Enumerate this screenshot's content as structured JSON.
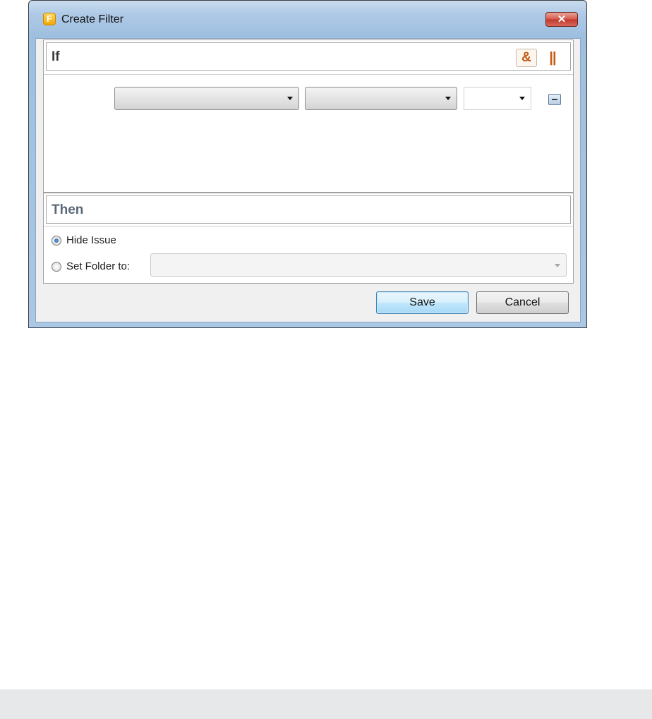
{
  "window": {
    "title": "Create Filter",
    "app_icon_letter": "F",
    "close_symbol": "✕"
  },
  "if_section": {
    "heading": "If",
    "and_label": "&",
    "or_label": "||",
    "condition_row": {
      "field_value": "",
      "operator_value": "",
      "value_value": ""
    }
  },
  "then_section": {
    "heading": "Then",
    "options": [
      {
        "label": "Hide Issue",
        "selected": true
      },
      {
        "label": "Set Folder to:",
        "selected": false
      }
    ],
    "folder_value": ""
  },
  "buttons": {
    "save": "Save",
    "cancel": "Cancel"
  },
  "colors": {
    "accent_orange": "#c4580f",
    "title_gradient": "#aec9e6",
    "save_border": "#3c7fb1"
  }
}
